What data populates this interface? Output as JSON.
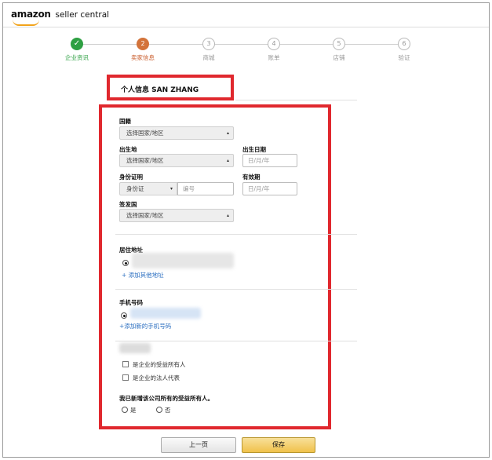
{
  "header": {
    "brand": "amazon",
    "sub": "seller central"
  },
  "steps": [
    {
      "num": "✓",
      "label": "企业资讯",
      "state": "done"
    },
    {
      "num": "2",
      "label": "卖家信息",
      "state": "active"
    },
    {
      "num": "3",
      "label": "商城",
      "state": "todo"
    },
    {
      "num": "4",
      "label": "账单",
      "state": "todo"
    },
    {
      "num": "5",
      "label": "店铺",
      "state": "todo"
    },
    {
      "num": "6",
      "label": "验证",
      "state": "todo"
    }
  ],
  "title": "个人信息 SAN ZHANG",
  "form": {
    "nationality_label": "国籍",
    "nationality_value": "选择国家/地区",
    "birthplace_label": "出生地",
    "birthplace_value": "选择国家/地区",
    "dob_label": "出生日期",
    "dob_placeholder": "日/月/年",
    "id_label": "身份证明",
    "id_type_value": "身份证",
    "id_number_placeholder": "编号",
    "expiry_label": "有效期",
    "expiry_placeholder": "日/月/年",
    "issuer_label": "签发国",
    "issuer_value": "选择国家/地区",
    "address_label": "居住地址",
    "add_address_link": "+ 添加其他地址",
    "phone_label": "手机号码",
    "add_phone_link": "+添加新的手机号码",
    "beneficiary_checkbox": "是企业的受益所有人",
    "legal_rep_checkbox": "是企业的法人代表",
    "confirm_question": "我已新增该公司所有的受益所有人。",
    "yes_label": "是",
    "no_label": "否"
  },
  "buttons": {
    "prev": "上一页",
    "save": "保存"
  }
}
